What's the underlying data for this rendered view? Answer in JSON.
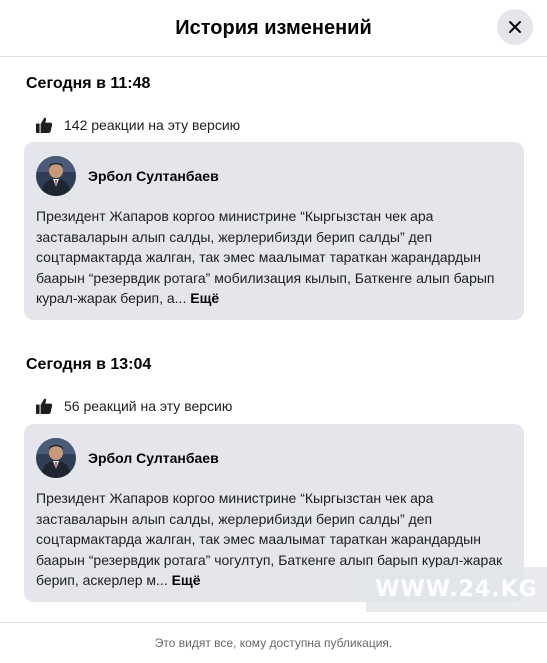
{
  "dialog": {
    "title": "История изменений",
    "close_icon": "close-icon"
  },
  "versions": [
    {
      "time_label": "Сегодня в 11:48",
      "reactions_text": "142 реакции на эту версию",
      "author": "Эрбол Султанбаев",
      "text": "Президент Жапаров коргоо министрине “Кыргызстан чек ара заставаларын алып салды, жерлерибизди берип салды” деп соцтармактарда жалган, так эмес маалымат тараткан жарандардын баарын “резервдик ротага” мобилизация кылып, Баткенге алып барып курал-жарак берип, а...",
      "more_label": "Ещё"
    },
    {
      "time_label": "Сегодня в 13:04",
      "reactions_text": "56 реакций на эту версию",
      "author": "Эрбол Султанбаев",
      "text": "Президент Жапаров коргоо министрине “Кыргызстан чек ара заставаларын алып салды, жерлерибизди берип салды” деп соцтармактарда жалган, так эмес маалымат тараткан жарандардын баарын “резервдик ротага” чогултуп, Баткенге алып барып курал-жарак берип, аскерлер м...",
      "more_label": "Ещё"
    }
  ],
  "watermark": "WWW.24.KG",
  "footer_text": "Это видят все, кому доступна публикация.",
  "colors": {
    "card_bg": "#e4e6eb",
    "muted_text": "#65676b",
    "divider": "#dddfe2"
  }
}
